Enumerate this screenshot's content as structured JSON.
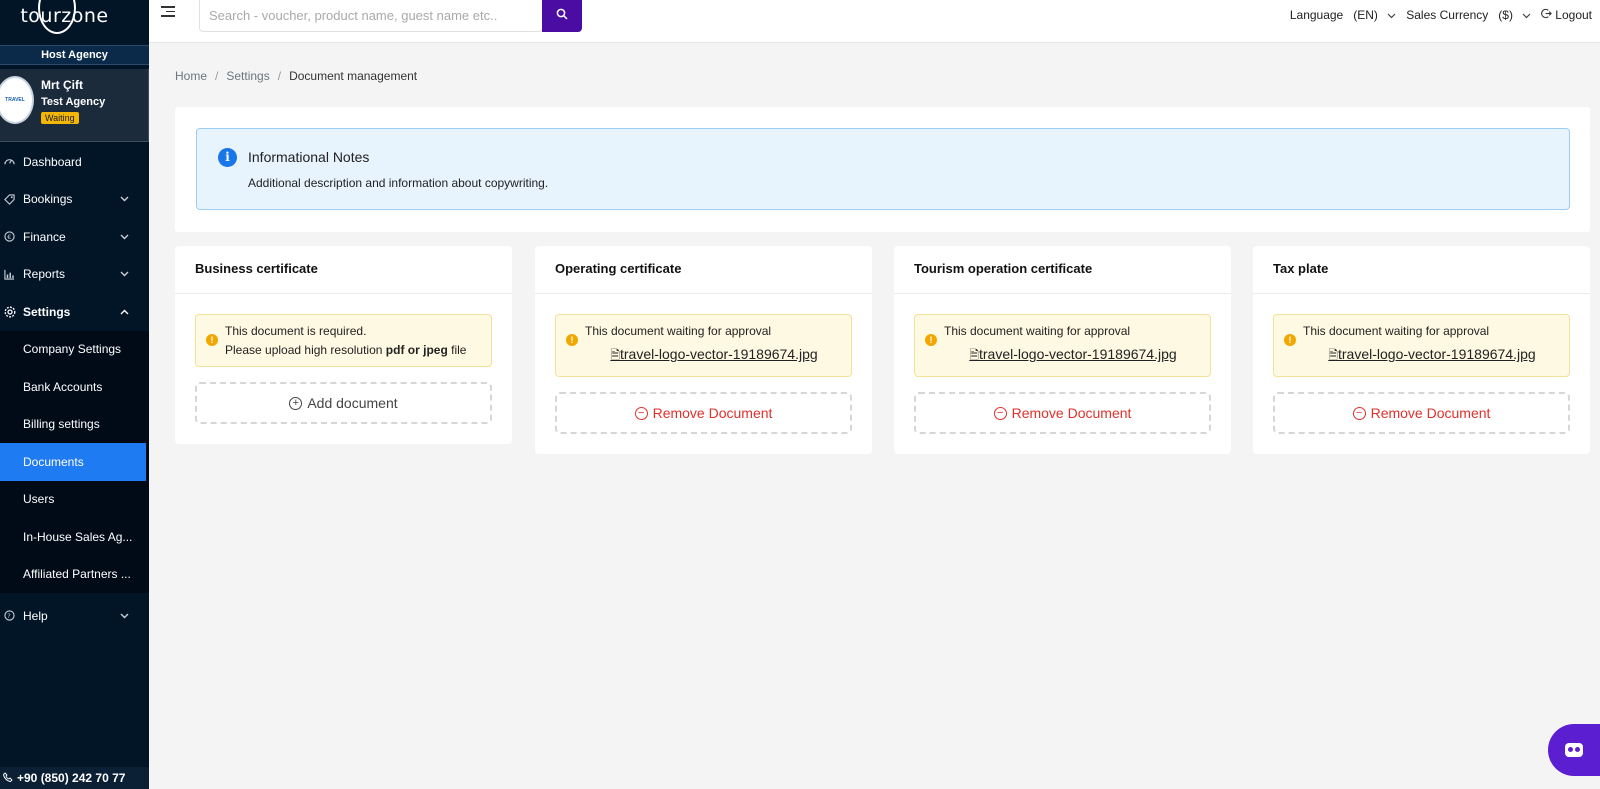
{
  "brand": {
    "logo_text": "tourzone"
  },
  "sidebar": {
    "host_agency": "Host Agency",
    "profile": {
      "name": "Mrt Çift",
      "agency": "Test Agency",
      "status": "Waiting",
      "avatar_text": "TRAVEL"
    },
    "items": [
      {
        "label": "Dashboard",
        "icon": "dashboard-icon"
      },
      {
        "label": "Bookings",
        "icon": "tag-icon"
      },
      {
        "label": "Finance",
        "icon": "currency-icon"
      },
      {
        "label": "Reports",
        "icon": "chart-icon"
      },
      {
        "label": "Settings",
        "icon": "gear-icon"
      }
    ],
    "settings_sub": [
      {
        "label": "Company Settings"
      },
      {
        "label": "Bank Accounts"
      },
      {
        "label": "Billing settings"
      },
      {
        "label": "Documents"
      },
      {
        "label": "Users"
      },
      {
        "label": "In-House Sales Ag..."
      },
      {
        "label": "Affiliated Partners ..."
      }
    ],
    "help": {
      "label": "Help"
    },
    "phone": "+90 (850) 242 70 77"
  },
  "topbar": {
    "search_placeholder": "Search - voucher, product name, guest name etc..",
    "language_label": "Language",
    "language_value": "(EN)",
    "currency_label": "Sales Currency",
    "currency_value": "($)",
    "logout_label": "Logout"
  },
  "breadcrumb": {
    "home": "Home",
    "settings": "Settings",
    "current": "Document management"
  },
  "info": {
    "title": "Informational Notes",
    "description": "Additional description and information about copywriting."
  },
  "cards": [
    {
      "title": "Business certificate",
      "alert_line1": "This document is required.",
      "alert_line2_prefix": "Please upload high resolution ",
      "alert_line2_bold": "pdf or jpeg",
      "alert_line2_suffix": " file",
      "button": "Add document"
    },
    {
      "title": "Operating certificate",
      "alert_line1": "This document waiting for approval",
      "file": "travel-logo-vector-19189674.jpg",
      "button": "Remove Document"
    },
    {
      "title": "Tourism operation certificate",
      "alert_line1": "This document waiting for approval",
      "file": "travel-logo-vector-19189674.jpg",
      "button": "Remove Document"
    },
    {
      "title": "Tax plate",
      "alert_line1": "This document waiting for approval",
      "file": "travel-logo-vector-19189674.jpg",
      "button": "Remove Document"
    }
  ],
  "colors": {
    "sidebar_bg": "#021527",
    "active_item": "#1e7bf2",
    "search_button": "#4a0ca3",
    "info_bg": "#e7f3fd",
    "warning_bg": "#fef9e2",
    "remove_text": "#e0312c",
    "chat_bubble": "#5b1fd1"
  }
}
